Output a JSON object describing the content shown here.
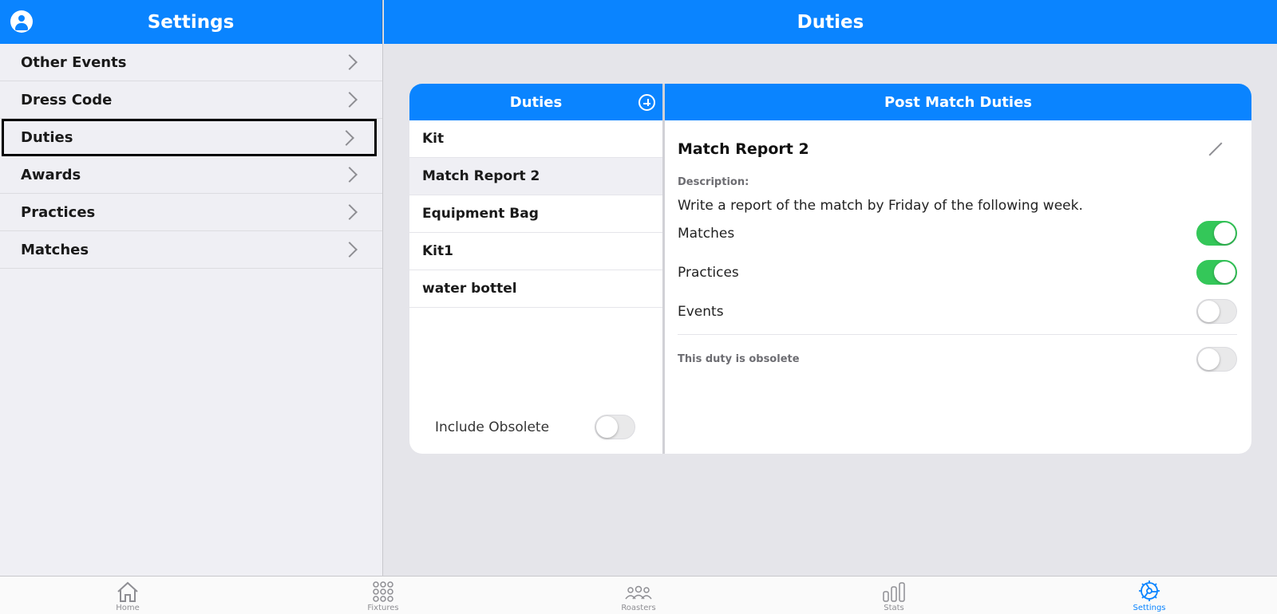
{
  "sidebar": {
    "title": "Settings",
    "items": [
      {
        "label": "Other Events"
      },
      {
        "label": "Dress Code"
      },
      {
        "label": "Duties"
      },
      {
        "label": "Awards"
      },
      {
        "label": "Practices"
      },
      {
        "label": "Matches"
      }
    ]
  },
  "main": {
    "title": "Duties",
    "list": {
      "header": "Duties",
      "items": [
        {
          "label": "Kit"
        },
        {
          "label": "Match Report 2"
        },
        {
          "label": "Equipment Bag"
        },
        {
          "label": "Kit1"
        },
        {
          "label": "water bottel"
        }
      ],
      "include_obsolete_label": "Include Obsolete"
    },
    "detail": {
      "header": "Post Match Duties",
      "name": "Match Report 2",
      "description_label": "Description:",
      "description": "Write a report of the match by Friday of the following week.",
      "options": [
        {
          "label": "Matches"
        },
        {
          "label": "Practices"
        },
        {
          "label": "Events"
        }
      ],
      "obsolete_label": "This duty is obsolete"
    }
  },
  "tabbar": {
    "tabs": [
      {
        "label": "Home"
      },
      {
        "label": "Fixtures"
      },
      {
        "label": "Roasters"
      },
      {
        "label": "Stats"
      },
      {
        "label": "Settings"
      }
    ]
  },
  "colors": {
    "accent": "#0a84ff",
    "toggle_on": "#34c759",
    "background": "#e5e5ea"
  }
}
